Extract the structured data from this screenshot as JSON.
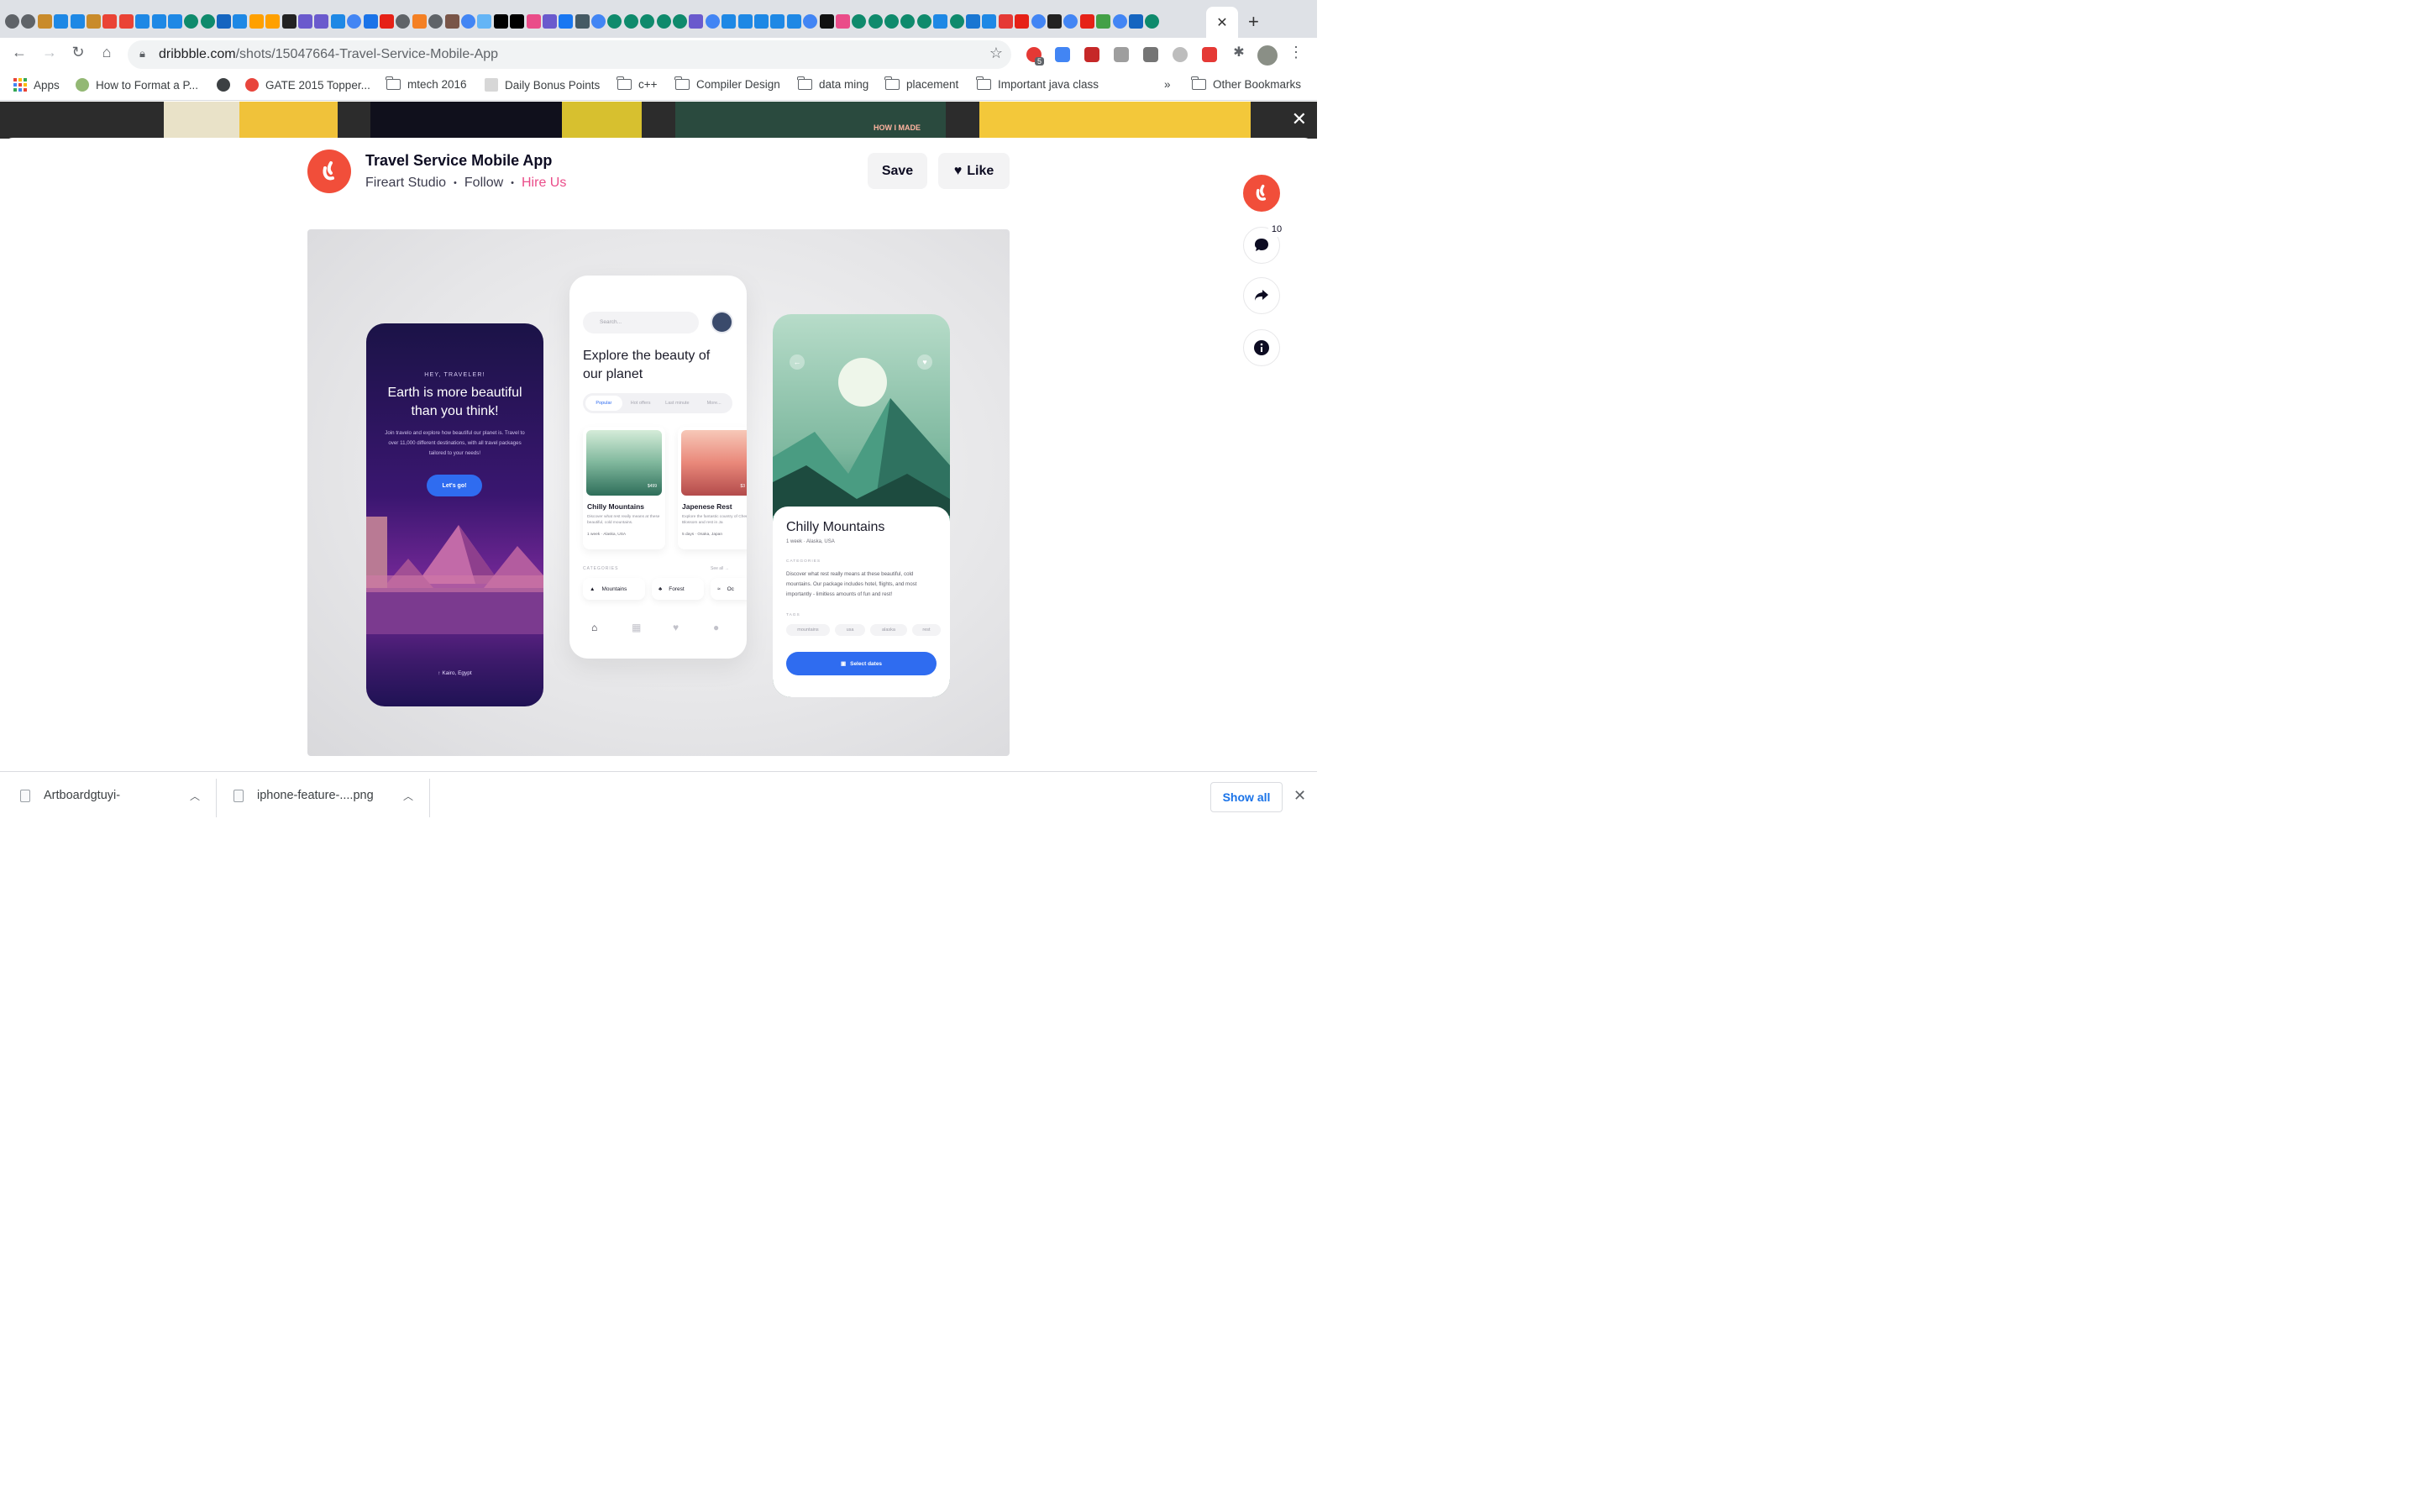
{
  "browser": {
    "tab_icons": [
      "apple",
      "apple",
      "phone",
      "appstore",
      "appstore",
      "phone",
      "gmail",
      "gmail",
      "appstore",
      "appstore",
      "appstore",
      "chatgpt",
      "chatgpt",
      "m-app",
      "appstore",
      "firebase",
      "firebase",
      "notion",
      "diamond",
      "diamond",
      "appstore",
      "google",
      "leetcode",
      "youtube",
      "apple",
      "stack",
      "apple",
      "cat",
      "google",
      "arrow",
      "n-app",
      "black",
      "dribbble",
      "diamond",
      "facebook",
      "terminal",
      "google",
      "chatgpt",
      "chatgpt",
      "chatgpt",
      "chatgpt",
      "chatgpt",
      "diamond",
      "google",
      "appstore",
      "appstore",
      "appstore",
      "appstore",
      "appstore",
      "google",
      "ai-black",
      "dribbble",
      "chatgpt",
      "chatgpt",
      "chatgpt",
      "chatgpt",
      "chatgpt",
      "appstore",
      "chatgpt",
      "clock",
      "appstore",
      "c-red",
      "youtube",
      "google",
      "amazon",
      "google",
      "youtube",
      "check",
      "google",
      "code",
      "chatgpt"
    ],
    "active_tab_close": "✕",
    "new_tab": "+",
    "url_host": "dribbble.com",
    "url_path": "/shots/15047664-Travel-Service-Mobile-App",
    "ext_badge": "5",
    "bookmarks": [
      {
        "label": "Apps",
        "icon": "apps-grid-icon"
      },
      {
        "label": "How to Format a P...",
        "icon": "wikihow-icon"
      },
      {
        "label": "",
        "icon": "globe-icon"
      },
      {
        "label": "GATE 2015 Topper...",
        "icon": "gate-icon"
      },
      {
        "label": "mtech 2016",
        "icon": "folder-icon"
      },
      {
        "label": "Daily Bonus Points",
        "icon": "vtop-icon"
      },
      {
        "label": "c++",
        "icon": "folder-icon"
      },
      {
        "label": "Compiler Design",
        "icon": "folder-icon"
      },
      {
        "label": "data ming",
        "icon": "folder-icon"
      },
      {
        "label": "placement",
        "icon": "folder-icon"
      },
      {
        "label": "Important java class",
        "icon": "folder-icon"
      }
    ],
    "overflow": "»",
    "other_bookmarks": "Other Bookmarks"
  },
  "backdrop": {
    "thumb_caption": "HOW I MADE",
    "close": "✕"
  },
  "shot": {
    "title": "Travel Service Mobile App",
    "author": "Fireart Studio",
    "separator": "•",
    "follow": "Follow",
    "hire": "Hire Us",
    "save": "Save",
    "like": "Like",
    "comment_count": "10"
  },
  "mockup": {
    "p1": {
      "greeting": "HEY, TRAVELER!",
      "headline": "Earth is more beautiful than you think!",
      "description": "Join travelo and explore how beautiful our planet is. Travel to over 11,000 different destinations, with all travel packages tailored to your needs!",
      "cta": "Let's go!",
      "location": "Kairo, Egypt"
    },
    "p2": {
      "search_placeholder": "Search...",
      "heading": "Explore the beauty of our planet",
      "tabs": [
        "Popular",
        "Hot offers",
        "Last minute",
        "More..."
      ],
      "cards": [
        {
          "name": "Chilly Mountains",
          "desc": "Discover what rest really means at these beautiful, cold mountains.",
          "meta": "1 week · Alaska, USA",
          "price": "$499"
        },
        {
          "name": "Japenese Rest",
          "desc": "Explore the fantastic country of Cherry Blossom and rest in Ja",
          "meta": "5 days · Osaka, Japan",
          "price": "$3"
        }
      ],
      "categories_label": "CATEGORIES",
      "see_all": "See all →",
      "categories": [
        "Mountains",
        "Forest",
        "Oc"
      ]
    },
    "p3": {
      "name": "Chilly Mountains",
      "meta": "1 week · Alaska, USA",
      "categories_label": "CATEGORIES",
      "description": "Discover what rest really means at these beautiful, cold mountains. Our package includes hotel, flights, and most importantly - limitless amounts of fun and rest!",
      "tags_label": "TAGS",
      "tags": [
        "mountains",
        "usa",
        "alaska",
        "rest"
      ],
      "cta": "Select dates"
    }
  },
  "downloads": {
    "items": [
      "Artboardgtuyi-",
      "iphone-feature-....png"
    ],
    "show_all": "Show all",
    "close": "✕"
  },
  "colors": {
    "brand_pink": "#ea4c89",
    "avatar_orange": "#f14e3a",
    "cta_blue": "#2f6cf0",
    "link_blue": "#1a73e8"
  }
}
